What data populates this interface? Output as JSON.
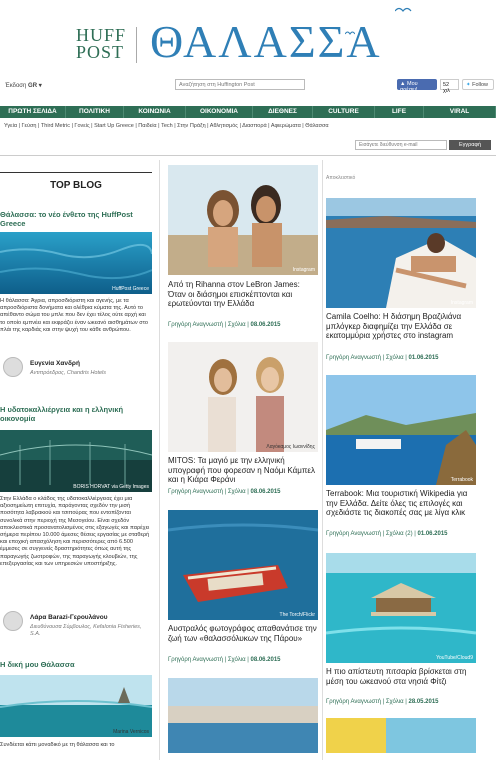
{
  "header": {
    "huff": "HUFF",
    "post": "POST",
    "title": "ΘΑΛΑΣΣΑ"
  },
  "toolbar": {
    "edition_label": "Έκδοση",
    "edition_value": "GR ▾",
    "search_placeholder": "Αναζήτηση στη Huffington Post",
    "fb_label": "Μου αρέσει!",
    "fb_count": "52 χιλ",
    "tw_label": "Follow"
  },
  "nav": [
    "ΠΡΩΤΗ ΣΕΛΙΔΑ",
    "ΠΟΛΙΤΙΚΗ",
    "ΚΟΙΝΩΝΙΑ",
    "ΟΙΚΟΝΟΜΙΑ",
    "ΔΙΕΘΝΕΣ",
    "CULTURE",
    "LIFE",
    "VIRAL"
  ],
  "subnav": "Υγεία  |  Γεύση  |  Third Metric  |  Γονείς  |  Start Up Greece  |  Παιδεία  |  Tech  |  Στην Πράξη  |  Αθλητισμός  |  Διασπορά  |  Αφιερώματα  |  Θάλασσα",
  "newsletter": {
    "placeholder": "Εισάγετε διεύθυνση e-mail",
    "button": "Εγγραφή"
  },
  "col1": {
    "heading": "TOP BLOG",
    "b1_title": "Θάλασσα: το νέο ένθετο της HuffPost Greece",
    "b1_caption": "HuffPost Greece",
    "b1_text": "Η θάλασσα: Άγρια, απροσδιόριστη και αγενής, με τα απροσδιόριστα δονήματα και ολέθρια κύματα της. Αυτό το απέθαντο σώμα του μπλε που δεν έχει τέλος ούτε αρχή και το οποίο εμπνέει και εκφράζει έναν ωκεανό αισθημάτων στο πλάι της καρδιάς και στην ψυχή του κάθε ανθρώπου.",
    "b1_author": "Ευγενία Χανδρή",
    "b1_author_role": "Αντιπρόεδρος, Chandris Hotels",
    "b2_title": "Η υδατοκαλλιέργεια και η ελληνική οικονομία",
    "b2_caption": "BORIS HORVAT via Getty Images",
    "b2_text": "Στην Ελλάδα ο κλάδος της υδατοκαλλιέργειας έχει μια αξιοσημείωτη επιτυχία, παράγοντας σχεδόν την μισή ποσότητα λαβρακιού και τσιπούρας που εντοπίζονται συνολικά στην περιοχή της Μεσογείου. Είναι σχεδόν αποκλειστικά προσανατολισμένος στις εξαγωγές και παρέχει σήμερα περίπου 10.000 άμεσες θέσεις εργασίας με σταθερή και εποχική απασχόληση και περισσότερες από 6.500 έμμεσες σε συγγενείς δραστηριότητες όπως αυτή της παραγωγής ζωοτροφών, της παραγωγής κλουβιών, της επεξεργασίας και των υπηρεσιών υποστήριξης.",
    "b2_author": "Λάρα Barazi-Γερουλάνου",
    "b2_author_role": "Διευθύνουσα Σύμβουλος, Kefalonia Fisheries, S.A.",
    "b3_title": "Η δική μου Θάλασσα",
    "b3_caption": "Marina Vernicos",
    "b3_text": "Συνδέεται κάπι μοναδικό με τη θάλασσα και το"
  },
  "col2": {
    "a1_caption": "Instagram",
    "a1_title": "Από τη Rihanna στον LeBron James: Όταν οι διάσημοι επισκέπτονται και ερωτεύονται την Ελλάδα",
    "a1_meta": "Γρηγόρη Αναγνωστή",
    "a1_sec": "Σχόλια",
    "a1_date": "08.06.2015",
    "a2_caption": "Λαγόκαμος Ιωαννίδης",
    "a2_title": "MITOS: Τα μαγιό με την ελληνική υπογραφή που φορεσαν η Ναόμι Κάμπελ και η Κιάρα Φεράνι",
    "a2_meta": "Γρηγόρη Αναγνωστή",
    "a2_sec": "Σχόλια",
    "a2_date": "08.06.2015",
    "a3_caption": "The Torch/Flickr",
    "a3_title": "Αυστραλός φωτογράφος απαθανάτισε την ζωή των «θαλασσόλυκων της Πάρου»",
    "a3_meta": "Γρηγόρη Αναγνωστή",
    "a3_sec": "Σχόλια",
    "a3_date": "08.06.2015"
  },
  "col3": {
    "label": "Αποκλειστικό",
    "a1_caption": "Instagram",
    "a1_title": "Camila Coelho: Η διάσημη Βραζιλιάνα μπλόγκερ διαφημίζει την Ελλάδα σε εκατομμύρια χρήστες στο instagram",
    "a1_meta": "Γρηγόρη Αναγνωστή",
    "a1_sec": "Σχόλια",
    "a1_date": "01.06.2015",
    "a2_caption": "Terrabook",
    "a2_title": "Terrabook: Μια τουριστική Wikipedia για την Ελλάδα. Δείτε όλες τις επιλογές και σχεδιάστε τις διακοπές σας με λίγα κλικ",
    "a2_meta": "Γρηγόρη Αναγνωστή",
    "a2_sec": "Σχόλια (2)",
    "a2_date": "01.06.2015",
    "a3_caption": "YouTube/Cloud9",
    "a3_title": "Η πιο απίστευτη πιτσαρία βρίσκεται στη μέση του ωκεανού στα νησιά Φίτζι",
    "a3_meta": "Γρηγόρη Αναγνωστή",
    "a3_sec": "Σχόλια",
    "a3_date": "28.05.2015"
  }
}
